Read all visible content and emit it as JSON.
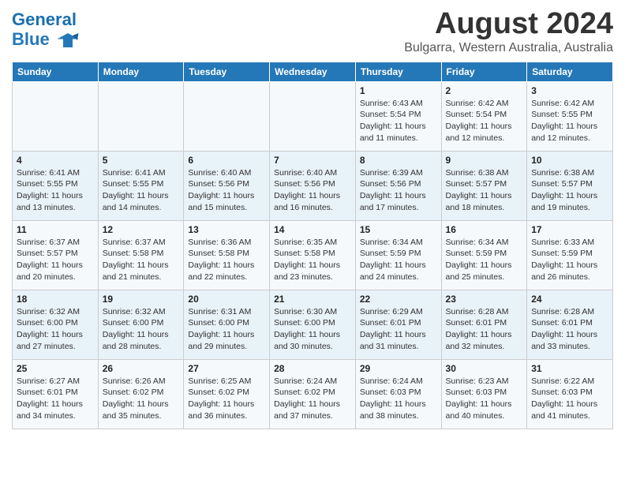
{
  "header": {
    "logo_line1": "General",
    "logo_line2": "Blue",
    "month": "August 2024",
    "location": "Bulgarra, Western Australia, Australia"
  },
  "weekdays": [
    "Sunday",
    "Monday",
    "Tuesday",
    "Wednesday",
    "Thursday",
    "Friday",
    "Saturday"
  ],
  "weeks": [
    [
      {
        "day": "",
        "info": ""
      },
      {
        "day": "",
        "info": ""
      },
      {
        "day": "",
        "info": ""
      },
      {
        "day": "",
        "info": ""
      },
      {
        "day": "1",
        "info": "Sunrise: 6:43 AM\nSunset: 5:54 PM\nDaylight: 11 hours and 11 minutes."
      },
      {
        "day": "2",
        "info": "Sunrise: 6:42 AM\nSunset: 5:54 PM\nDaylight: 11 hours and 12 minutes."
      },
      {
        "day": "3",
        "info": "Sunrise: 6:42 AM\nSunset: 5:55 PM\nDaylight: 11 hours and 12 minutes."
      }
    ],
    [
      {
        "day": "4",
        "info": "Sunrise: 6:41 AM\nSunset: 5:55 PM\nDaylight: 11 hours and 13 minutes."
      },
      {
        "day": "5",
        "info": "Sunrise: 6:41 AM\nSunset: 5:55 PM\nDaylight: 11 hours and 14 minutes."
      },
      {
        "day": "6",
        "info": "Sunrise: 6:40 AM\nSunset: 5:56 PM\nDaylight: 11 hours and 15 minutes."
      },
      {
        "day": "7",
        "info": "Sunrise: 6:40 AM\nSunset: 5:56 PM\nDaylight: 11 hours and 16 minutes."
      },
      {
        "day": "8",
        "info": "Sunrise: 6:39 AM\nSunset: 5:56 PM\nDaylight: 11 hours and 17 minutes."
      },
      {
        "day": "9",
        "info": "Sunrise: 6:38 AM\nSunset: 5:57 PM\nDaylight: 11 hours and 18 minutes."
      },
      {
        "day": "10",
        "info": "Sunrise: 6:38 AM\nSunset: 5:57 PM\nDaylight: 11 hours and 19 minutes."
      }
    ],
    [
      {
        "day": "11",
        "info": "Sunrise: 6:37 AM\nSunset: 5:57 PM\nDaylight: 11 hours and 20 minutes."
      },
      {
        "day": "12",
        "info": "Sunrise: 6:37 AM\nSunset: 5:58 PM\nDaylight: 11 hours and 21 minutes."
      },
      {
        "day": "13",
        "info": "Sunrise: 6:36 AM\nSunset: 5:58 PM\nDaylight: 11 hours and 22 minutes."
      },
      {
        "day": "14",
        "info": "Sunrise: 6:35 AM\nSunset: 5:58 PM\nDaylight: 11 hours and 23 minutes."
      },
      {
        "day": "15",
        "info": "Sunrise: 6:34 AM\nSunset: 5:59 PM\nDaylight: 11 hours and 24 minutes."
      },
      {
        "day": "16",
        "info": "Sunrise: 6:34 AM\nSunset: 5:59 PM\nDaylight: 11 hours and 25 minutes."
      },
      {
        "day": "17",
        "info": "Sunrise: 6:33 AM\nSunset: 5:59 PM\nDaylight: 11 hours and 26 minutes."
      }
    ],
    [
      {
        "day": "18",
        "info": "Sunrise: 6:32 AM\nSunset: 6:00 PM\nDaylight: 11 hours and 27 minutes."
      },
      {
        "day": "19",
        "info": "Sunrise: 6:32 AM\nSunset: 6:00 PM\nDaylight: 11 hours and 28 minutes."
      },
      {
        "day": "20",
        "info": "Sunrise: 6:31 AM\nSunset: 6:00 PM\nDaylight: 11 hours and 29 minutes."
      },
      {
        "day": "21",
        "info": "Sunrise: 6:30 AM\nSunset: 6:00 PM\nDaylight: 11 hours and 30 minutes."
      },
      {
        "day": "22",
        "info": "Sunrise: 6:29 AM\nSunset: 6:01 PM\nDaylight: 11 hours and 31 minutes."
      },
      {
        "day": "23",
        "info": "Sunrise: 6:28 AM\nSunset: 6:01 PM\nDaylight: 11 hours and 32 minutes."
      },
      {
        "day": "24",
        "info": "Sunrise: 6:28 AM\nSunset: 6:01 PM\nDaylight: 11 hours and 33 minutes."
      }
    ],
    [
      {
        "day": "25",
        "info": "Sunrise: 6:27 AM\nSunset: 6:01 PM\nDaylight: 11 hours and 34 minutes."
      },
      {
        "day": "26",
        "info": "Sunrise: 6:26 AM\nSunset: 6:02 PM\nDaylight: 11 hours and 35 minutes."
      },
      {
        "day": "27",
        "info": "Sunrise: 6:25 AM\nSunset: 6:02 PM\nDaylight: 11 hours and 36 minutes."
      },
      {
        "day": "28",
        "info": "Sunrise: 6:24 AM\nSunset: 6:02 PM\nDaylight: 11 hours and 37 minutes."
      },
      {
        "day": "29",
        "info": "Sunrise: 6:24 AM\nSunset: 6:03 PM\nDaylight: 11 hours and 38 minutes."
      },
      {
        "day": "30",
        "info": "Sunrise: 6:23 AM\nSunset: 6:03 PM\nDaylight: 11 hours and 40 minutes."
      },
      {
        "day": "31",
        "info": "Sunrise: 6:22 AM\nSunset: 6:03 PM\nDaylight: 11 hours and 41 minutes."
      }
    ]
  ]
}
